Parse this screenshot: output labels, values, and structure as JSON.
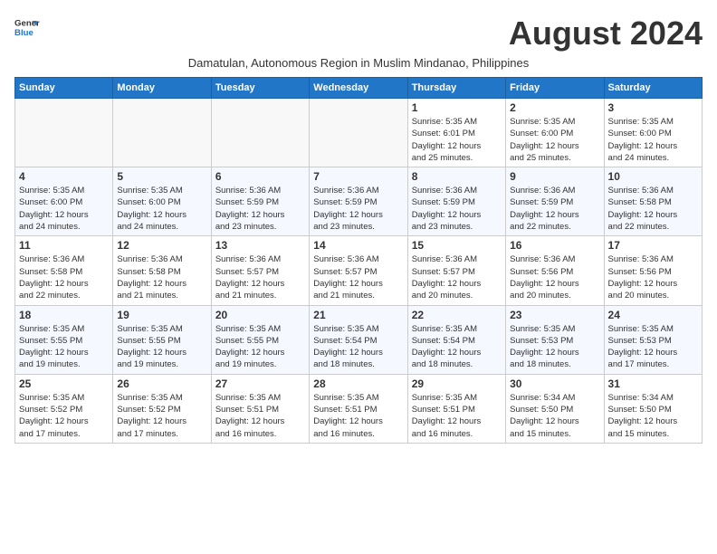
{
  "logo": {
    "line1": "General",
    "line2": "Blue"
  },
  "title": "August 2024",
  "subtitle": "Damatulan, Autonomous Region in Muslim Mindanao, Philippines",
  "days_of_week": [
    "Sunday",
    "Monday",
    "Tuesday",
    "Wednesday",
    "Thursday",
    "Friday",
    "Saturday"
  ],
  "weeks": [
    [
      {
        "day": "",
        "info": ""
      },
      {
        "day": "",
        "info": ""
      },
      {
        "day": "",
        "info": ""
      },
      {
        "day": "",
        "info": ""
      },
      {
        "day": "1",
        "info": "Sunrise: 5:35 AM\nSunset: 6:01 PM\nDaylight: 12 hours\nand 25 minutes."
      },
      {
        "day": "2",
        "info": "Sunrise: 5:35 AM\nSunset: 6:00 PM\nDaylight: 12 hours\nand 25 minutes."
      },
      {
        "day": "3",
        "info": "Sunrise: 5:35 AM\nSunset: 6:00 PM\nDaylight: 12 hours\nand 24 minutes."
      }
    ],
    [
      {
        "day": "4",
        "info": "Sunrise: 5:35 AM\nSunset: 6:00 PM\nDaylight: 12 hours\nand 24 minutes."
      },
      {
        "day": "5",
        "info": "Sunrise: 5:35 AM\nSunset: 6:00 PM\nDaylight: 12 hours\nand 24 minutes."
      },
      {
        "day": "6",
        "info": "Sunrise: 5:36 AM\nSunset: 5:59 PM\nDaylight: 12 hours\nand 23 minutes."
      },
      {
        "day": "7",
        "info": "Sunrise: 5:36 AM\nSunset: 5:59 PM\nDaylight: 12 hours\nand 23 minutes."
      },
      {
        "day": "8",
        "info": "Sunrise: 5:36 AM\nSunset: 5:59 PM\nDaylight: 12 hours\nand 23 minutes."
      },
      {
        "day": "9",
        "info": "Sunrise: 5:36 AM\nSunset: 5:59 PM\nDaylight: 12 hours\nand 22 minutes."
      },
      {
        "day": "10",
        "info": "Sunrise: 5:36 AM\nSunset: 5:58 PM\nDaylight: 12 hours\nand 22 minutes."
      }
    ],
    [
      {
        "day": "11",
        "info": "Sunrise: 5:36 AM\nSunset: 5:58 PM\nDaylight: 12 hours\nand 22 minutes."
      },
      {
        "day": "12",
        "info": "Sunrise: 5:36 AM\nSunset: 5:58 PM\nDaylight: 12 hours\nand 21 minutes."
      },
      {
        "day": "13",
        "info": "Sunrise: 5:36 AM\nSunset: 5:57 PM\nDaylight: 12 hours\nand 21 minutes."
      },
      {
        "day": "14",
        "info": "Sunrise: 5:36 AM\nSunset: 5:57 PM\nDaylight: 12 hours\nand 21 minutes."
      },
      {
        "day": "15",
        "info": "Sunrise: 5:36 AM\nSunset: 5:57 PM\nDaylight: 12 hours\nand 20 minutes."
      },
      {
        "day": "16",
        "info": "Sunrise: 5:36 AM\nSunset: 5:56 PM\nDaylight: 12 hours\nand 20 minutes."
      },
      {
        "day": "17",
        "info": "Sunrise: 5:36 AM\nSunset: 5:56 PM\nDaylight: 12 hours\nand 20 minutes."
      }
    ],
    [
      {
        "day": "18",
        "info": "Sunrise: 5:35 AM\nSunset: 5:55 PM\nDaylight: 12 hours\nand 19 minutes."
      },
      {
        "day": "19",
        "info": "Sunrise: 5:35 AM\nSunset: 5:55 PM\nDaylight: 12 hours\nand 19 minutes."
      },
      {
        "day": "20",
        "info": "Sunrise: 5:35 AM\nSunset: 5:55 PM\nDaylight: 12 hours\nand 19 minutes."
      },
      {
        "day": "21",
        "info": "Sunrise: 5:35 AM\nSunset: 5:54 PM\nDaylight: 12 hours\nand 18 minutes."
      },
      {
        "day": "22",
        "info": "Sunrise: 5:35 AM\nSunset: 5:54 PM\nDaylight: 12 hours\nand 18 minutes."
      },
      {
        "day": "23",
        "info": "Sunrise: 5:35 AM\nSunset: 5:53 PM\nDaylight: 12 hours\nand 18 minutes."
      },
      {
        "day": "24",
        "info": "Sunrise: 5:35 AM\nSunset: 5:53 PM\nDaylight: 12 hours\nand 17 minutes."
      }
    ],
    [
      {
        "day": "25",
        "info": "Sunrise: 5:35 AM\nSunset: 5:52 PM\nDaylight: 12 hours\nand 17 minutes."
      },
      {
        "day": "26",
        "info": "Sunrise: 5:35 AM\nSunset: 5:52 PM\nDaylight: 12 hours\nand 17 minutes."
      },
      {
        "day": "27",
        "info": "Sunrise: 5:35 AM\nSunset: 5:51 PM\nDaylight: 12 hours\nand 16 minutes."
      },
      {
        "day": "28",
        "info": "Sunrise: 5:35 AM\nSunset: 5:51 PM\nDaylight: 12 hours\nand 16 minutes."
      },
      {
        "day": "29",
        "info": "Sunrise: 5:35 AM\nSunset: 5:51 PM\nDaylight: 12 hours\nand 16 minutes."
      },
      {
        "day": "30",
        "info": "Sunrise: 5:34 AM\nSunset: 5:50 PM\nDaylight: 12 hours\nand 15 minutes."
      },
      {
        "day": "31",
        "info": "Sunrise: 5:34 AM\nSunset: 5:50 PM\nDaylight: 12 hours\nand 15 minutes."
      }
    ]
  ]
}
